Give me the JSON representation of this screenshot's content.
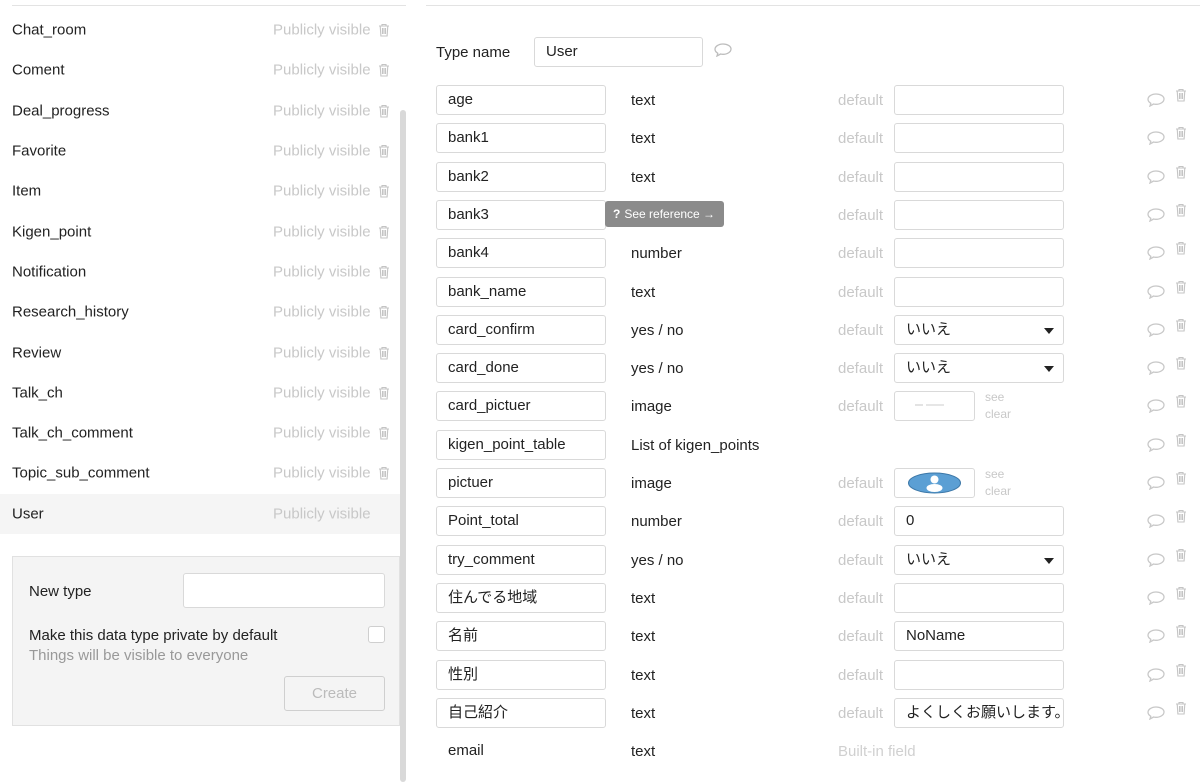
{
  "left_panel": {
    "types": [
      {
        "name": "Chat_room",
        "visibility": "Publicly visible",
        "selected": false
      },
      {
        "name": "Coment",
        "visibility": "Publicly visible",
        "selected": false
      },
      {
        "name": "Deal_progress",
        "visibility": "Publicly visible",
        "selected": false
      },
      {
        "name": "Favorite",
        "visibility": "Publicly visible",
        "selected": false
      },
      {
        "name": "Item",
        "visibility": "Publicly visible",
        "selected": false
      },
      {
        "name": "Kigen_point",
        "visibility": "Publicly visible",
        "selected": false
      },
      {
        "name": "Notification",
        "visibility": "Publicly visible",
        "selected": false
      },
      {
        "name": "Research_history",
        "visibility": "Publicly visible",
        "selected": false
      },
      {
        "name": "Review",
        "visibility": "Publicly visible",
        "selected": false
      },
      {
        "name": "Talk_ch",
        "visibility": "Publicly visible",
        "selected": false
      },
      {
        "name": "Talk_ch_comment",
        "visibility": "Publicly visible",
        "selected": false
      },
      {
        "name": "Topic_sub_comment",
        "visibility": "Publicly visible",
        "selected": false
      },
      {
        "name": "User",
        "visibility": "Publicly visible",
        "selected": true
      }
    ],
    "new_type": {
      "label": "New type",
      "input_value": "",
      "private_label": "Make this data type private by default",
      "private_checked": false,
      "private_help": "Things will be visible to everyone",
      "create_label": "Create"
    }
  },
  "right_panel": {
    "type_name_label": "Type name",
    "type_name_value": "User",
    "see_reference": "See reference →",
    "see_reference_mark": "?",
    "fields": [
      {
        "name": "age",
        "type": "text",
        "default_label": "default",
        "default_kind": "input",
        "default_value": ""
      },
      {
        "name": "bank1",
        "type": "text",
        "default_label": "default",
        "default_kind": "input",
        "default_value": ""
      },
      {
        "name": "bank2",
        "type": "text",
        "default_label": "default",
        "default_kind": "input",
        "default_value": ""
      },
      {
        "name": "bank3",
        "type": "",
        "default_label": "default",
        "default_kind": "input",
        "default_value": ""
      },
      {
        "name": "bank4",
        "type": "number",
        "default_label": "default",
        "default_kind": "input",
        "default_value": ""
      },
      {
        "name": "bank_name",
        "type": "text",
        "default_label": "default",
        "default_kind": "input",
        "default_value": ""
      },
      {
        "name": "card_confirm",
        "type": "yes / no",
        "default_label": "default",
        "default_kind": "select",
        "default_value": "いいえ"
      },
      {
        "name": "card_done",
        "type": "yes / no",
        "default_label": "default",
        "default_kind": "select",
        "default_value": "いいえ"
      },
      {
        "name": "card_pictuer",
        "type": "image",
        "default_label": "default",
        "default_kind": "image",
        "image_style": "blank",
        "see_label": "see",
        "clear_label": "clear"
      },
      {
        "name": "kigen_point_table",
        "type": "List of kigen_points",
        "default_label": "",
        "default_kind": "none"
      },
      {
        "name": "pictuer",
        "type": "image",
        "default_label": "default",
        "default_kind": "image",
        "image_style": "avatar",
        "see_label": "see",
        "clear_label": "clear"
      },
      {
        "name": "Point_total",
        "type": "number",
        "default_label": "default",
        "default_kind": "input",
        "default_value": "0"
      },
      {
        "name": "try_comment",
        "type": "yes / no",
        "default_label": "default",
        "default_kind": "select",
        "default_value": "いいえ"
      },
      {
        "name": "住んでる地域",
        "type": "text",
        "default_label": "default",
        "default_kind": "input",
        "default_value": ""
      },
      {
        "name": "名前",
        "type": "text",
        "default_label": "default",
        "default_kind": "input",
        "default_value": "NoName"
      },
      {
        "name": "性別",
        "type": "text",
        "default_label": "default",
        "default_kind": "input",
        "default_value": ""
      },
      {
        "name": "自己紹介",
        "type": "text",
        "default_label": "default",
        "default_kind": "input",
        "default_value": "よくしくお願いします。"
      },
      {
        "name": "email",
        "type": "text",
        "default_label": "Built-in field",
        "default_kind": "builtin",
        "plain": true
      }
    ]
  },
  "colors": {
    "muted_text": "#c8c8c8",
    "border": "#d9d9d9",
    "tooltip_bg": "#8b8b8b",
    "avatar_blue": "#5b9fd4"
  },
  "icons": {
    "delete": "trash-icon",
    "comment": "speech-bubble-icon",
    "dropdown": "caret-down-icon",
    "avatar": "user-avatar-icon"
  }
}
